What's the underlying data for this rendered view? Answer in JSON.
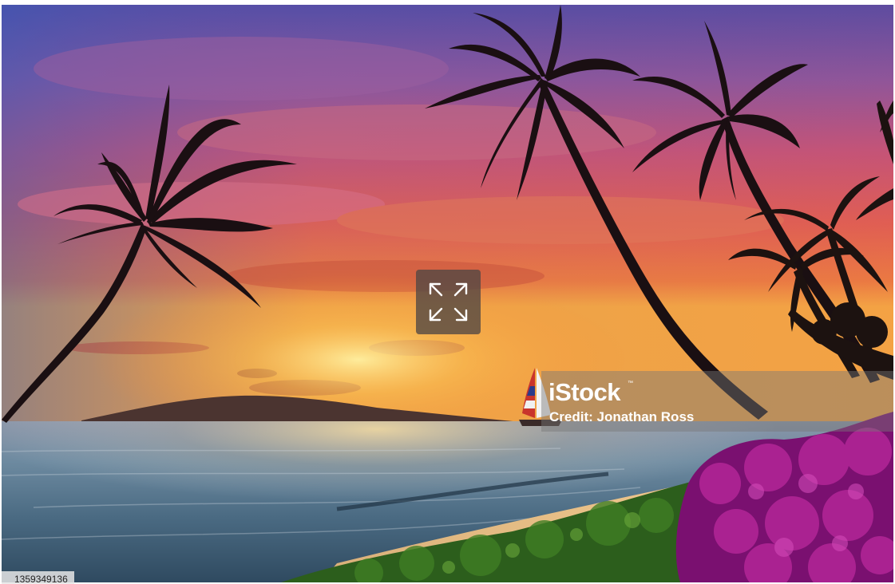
{
  "photo": {
    "alt": "Sunset over the ocean with palm tree silhouettes, a sailboat and flowering bushes"
  },
  "watermark": {
    "brand": "iStock",
    "trademark": "™",
    "credit": "Credit: Jonathan Ross"
  },
  "image_id": "1359349136",
  "controls": {
    "expand_icon": "expand-arrows-icon"
  },
  "colors": {
    "sky_top": "#5b5bb0",
    "sky_mid": "#c8577a",
    "sky_low": "#f06a3c",
    "horizon": "#ffb33a",
    "ocean": "#5e7a8c",
    "sand": "#e8c48a",
    "foliage": "#2f6a1f",
    "bougainvillea": "#a41a8c"
  }
}
